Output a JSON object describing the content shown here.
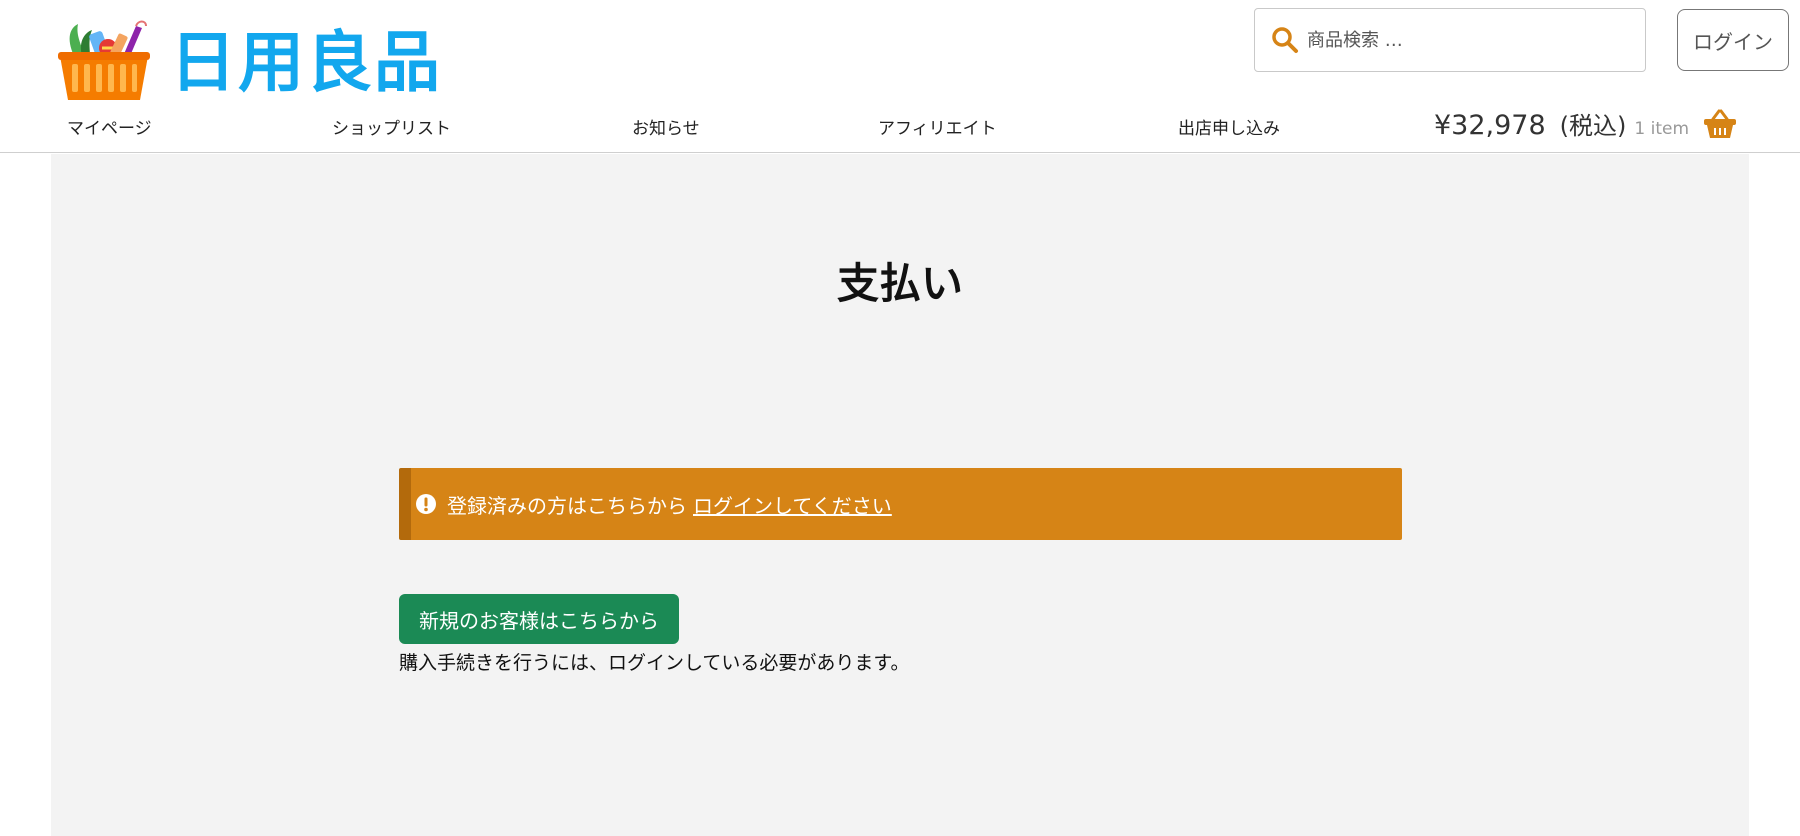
{
  "header": {
    "logo_text": "日用良品",
    "search": {
      "placeholder": "商品検索 …"
    },
    "login_label": "ログイン",
    "nav": [
      {
        "label": "マイページ"
      },
      {
        "label": "ショップリスト"
      },
      {
        "label": "お知らせ"
      },
      {
        "label": "アフィリエイト"
      },
      {
        "label": "出店申し込み"
      }
    ],
    "cart": {
      "price": "¥32,978",
      "tax_label": "(税込)",
      "item_count": "1 item",
      "icon": "basket-icon"
    }
  },
  "main": {
    "title": "支払い",
    "notice": {
      "icon": "exclamation-circle-icon",
      "text": "登録済みの方はこちらから",
      "link_label": "ログインしてください"
    },
    "new_customer_button": "新規のお客様はこちらから",
    "requirement_text": "購入手続きを行うには、ログインしている必要があります。"
  },
  "colors": {
    "logo": "#12a7ee",
    "accent_orange": "#d68416",
    "notice_border": "#b36a0c",
    "button_green": "#1b8a55",
    "main_bg": "#f3f3f3"
  }
}
